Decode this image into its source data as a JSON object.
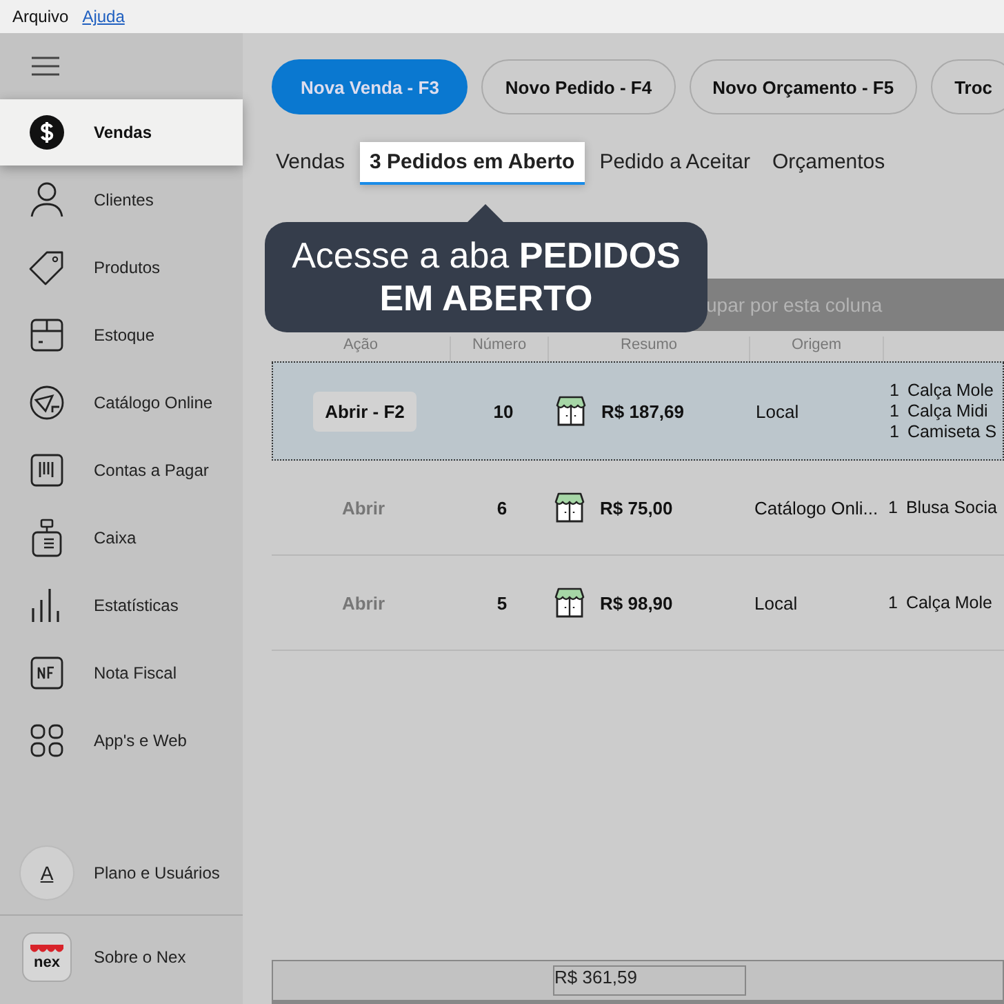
{
  "menu_bar": [
    {
      "label": "Arquivo",
      "selected": false
    },
    {
      "label": "Ajuda",
      "selected": true
    }
  ],
  "sidebar": {
    "items": [
      {
        "label": "Vendas",
        "selected": true
      },
      {
        "label": "Clientes",
        "selected": false
      },
      {
        "label": "Produtos",
        "selected": false
      },
      {
        "label": "Estoque",
        "selected": false
      },
      {
        "label": "Catálogo Online",
        "selected": false
      },
      {
        "label": "Contas a Pagar",
        "selected": false
      },
      {
        "label": "Caixa",
        "selected": false
      },
      {
        "label": "Estatísticas",
        "selected": false
      },
      {
        "label": "Nota Fiscal",
        "selected": false
      },
      {
        "label": "App's e Web",
        "selected": false
      }
    ],
    "account": {
      "avatar": "A",
      "label": "Plano e Usuários"
    },
    "about": {
      "logo_text": "nex",
      "label": "Sobre o Nex"
    }
  },
  "actions": [
    {
      "label": "Nova Venda - F3",
      "primary": true
    },
    {
      "label": "Novo Pedido - F4",
      "primary": false
    },
    {
      "label": "Novo Orçamento - F5",
      "primary": false
    },
    {
      "label": "Troc",
      "primary": false
    }
  ],
  "tabs": [
    {
      "label": "Vendas",
      "selected": false
    },
    {
      "label": "3 Pedidos em Aberto",
      "selected": true
    },
    {
      "label": "Pedido a Aceitar",
      "selected": false
    },
    {
      "label": "Orçamentos",
      "selected": false
    }
  ],
  "tooltip": "Acesse a aba **PEDIDOS EM ABERTO**",
  "group_bar": "upar por esta coluna",
  "table": {
    "columns": [
      "Ação",
      "Número",
      "Resumo",
      "Origem"
    ],
    "rows": [
      {
        "action": "Abrir - F2",
        "number": "10",
        "total": "R$ 187,69",
        "origin": "Local",
        "items": [
          {
            "qty": "1",
            "name": "Calça Mole"
          },
          {
            "qty": "1",
            "name": "Calça Midi"
          },
          {
            "qty": "1",
            "name": "Camiseta S"
          }
        ],
        "selected": true
      },
      {
        "action": "Abrir",
        "number": "6",
        "total": "R$ 75,00",
        "origin": "Catálogo Onli...",
        "items": [
          {
            "qty": "1",
            "name": "Blusa Socia"
          }
        ],
        "selected": false
      },
      {
        "action": "Abrir",
        "number": "5",
        "total": "R$ 98,90",
        "origin": "Local",
        "items": [
          {
            "qty": "1",
            "name": "Calça Mole"
          }
        ],
        "selected": false
      }
    ]
  },
  "summary": {
    "total": "R$ 361,59"
  }
}
